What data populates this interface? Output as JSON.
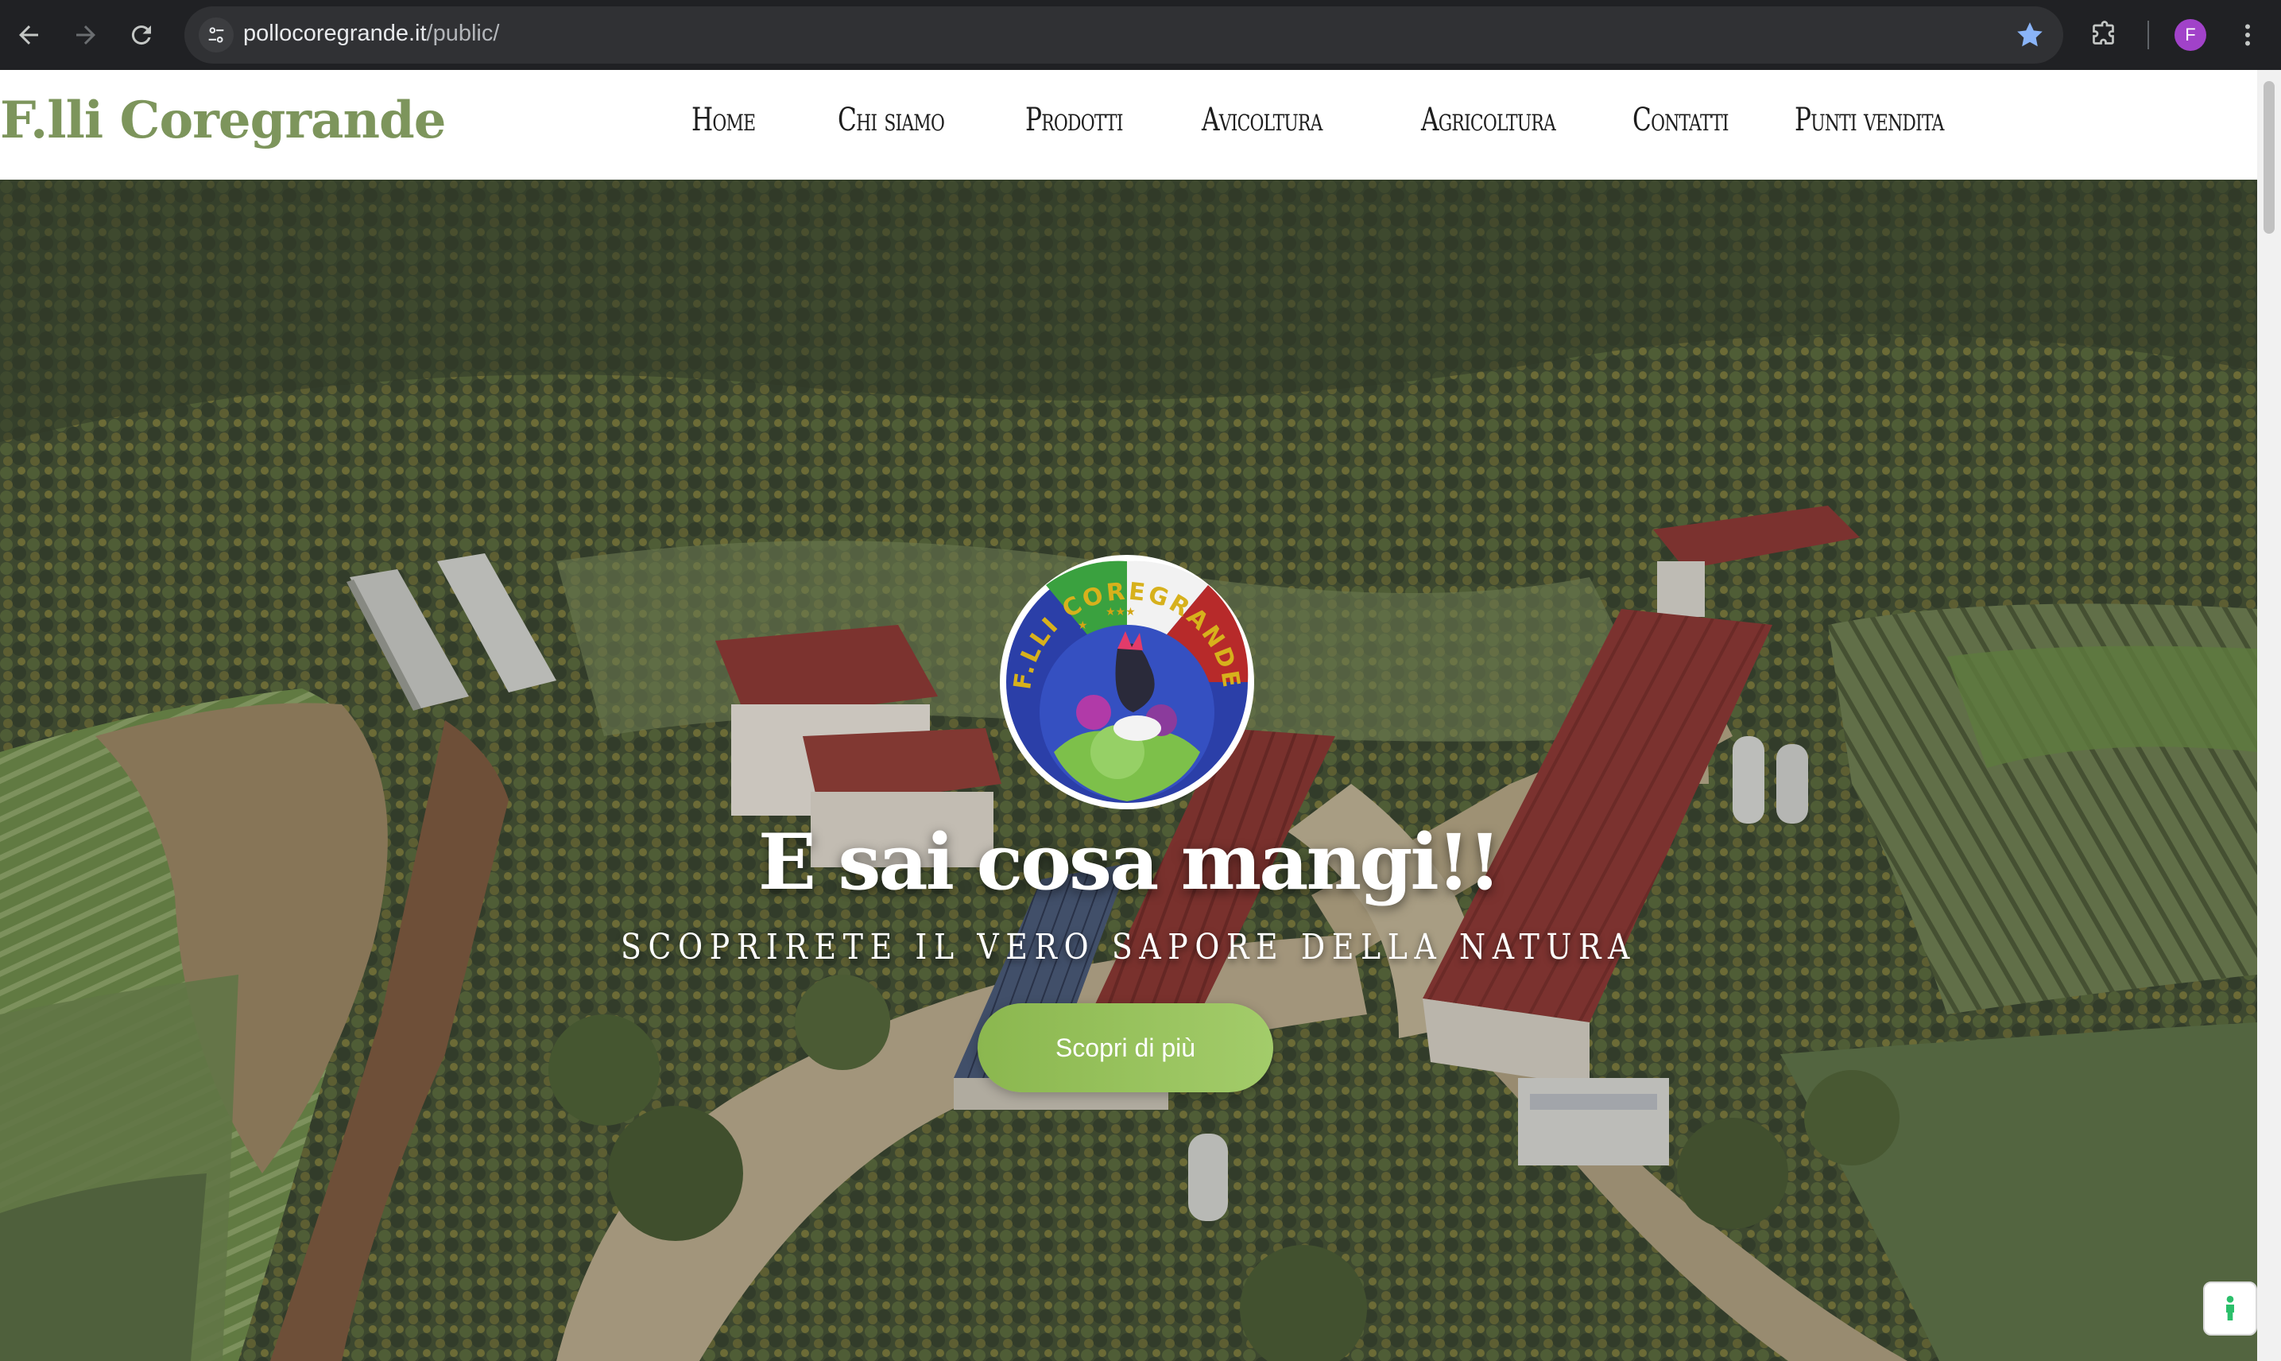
{
  "browser": {
    "url_host": "pollocoregrande.it",
    "url_path": "/public/",
    "profile_initial": "F",
    "icons": {
      "back": "arrow-left-icon",
      "forward": "arrow-right-icon",
      "reload": "reload-icon",
      "site_info": "tune-icon",
      "bookmark": "star-icon",
      "extensions": "puzzle-icon",
      "menu": "kebab-menu-icon"
    },
    "colors": {
      "bookmark_star": "#8ab4f8",
      "avatar": "#a142c9"
    }
  },
  "header": {
    "brand": "F.lli Coregrande",
    "brand_color": "#7d955c",
    "menu": [
      {
        "label": "Home"
      },
      {
        "label": "Chi siamo"
      },
      {
        "label": "Prodotti"
      },
      {
        "label": "Avicoltura"
      },
      {
        "label": "Agricoltura"
      },
      {
        "label": "Contatti"
      },
      {
        "label": "Punti vendita"
      }
    ]
  },
  "hero": {
    "logo_text_top": "F.LLI COREGRANDE",
    "title": "E sai cosa mangi!!",
    "subtitle": "Scoprirete il vero sapore della natura",
    "cta_label": "Scopri di più",
    "cta_color": "#96c15b"
  }
}
